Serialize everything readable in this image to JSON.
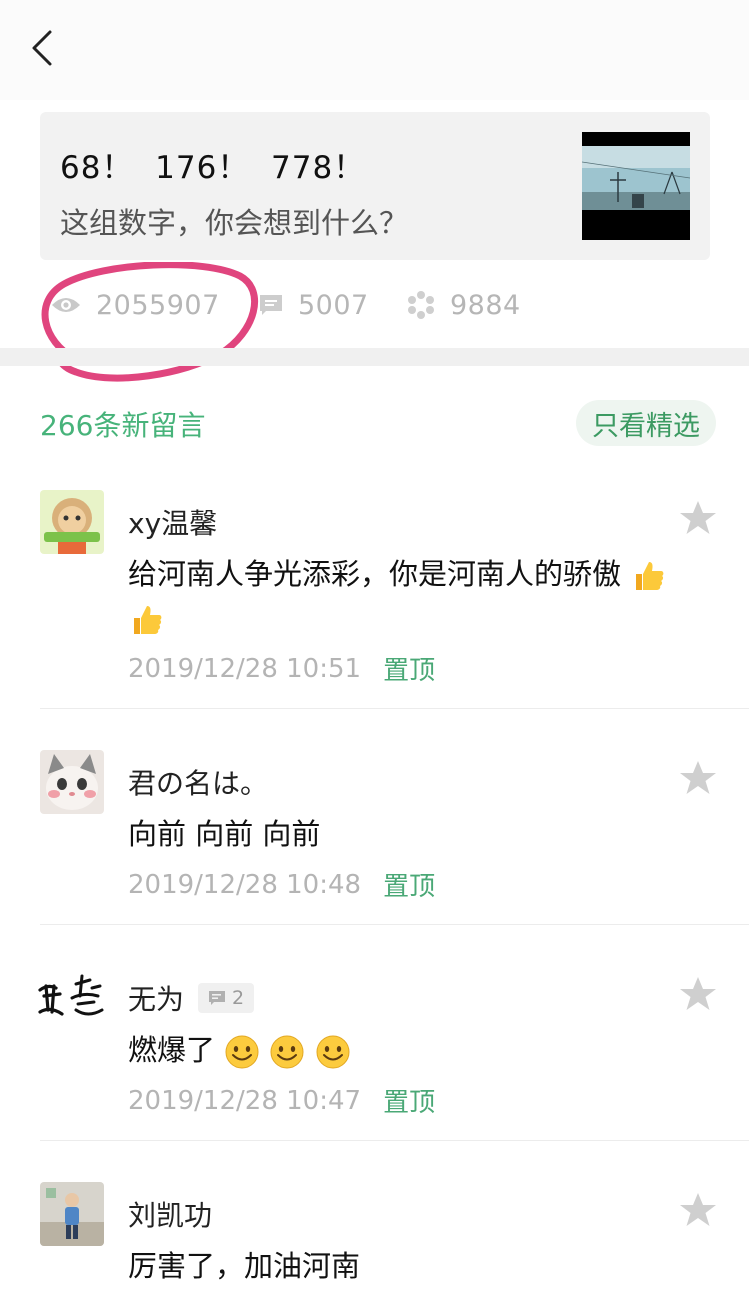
{
  "nav": {
    "back_icon": "chevron-left-icon"
  },
  "article": {
    "title": "68！  176！  778！",
    "subtitle": "这组数字，你会想到什么？"
  },
  "stats": {
    "views": "2055907",
    "comments": "5007",
    "likes": "9884"
  },
  "comments_header": {
    "count_label": "266条新留言",
    "filter_label": "只看精选"
  },
  "comments": [
    {
      "name": "xy温馨",
      "text": "给河南人争光添彩，你是河南人的骄傲",
      "emoji": [
        "thumbs-up",
        "thumbs-up"
      ],
      "time": "2019/12/28 10:51",
      "pin": "置顶"
    },
    {
      "name": "君の名は。",
      "text": "向前 向前 向前",
      "time": "2019/12/28 10:48",
      "pin": "置顶"
    },
    {
      "name": "无为",
      "reply_count": "2",
      "text": "燃爆了",
      "emoji": [
        "smile",
        "smile",
        "smile"
      ],
      "time": "2019/12/28 10:47",
      "pin": "置顶"
    },
    {
      "name": "刘凯功",
      "text": "厉害了，加油河南"
    }
  ],
  "colors": {
    "accent_green": "#47b37a",
    "highlight_pink": "#e0457e"
  }
}
